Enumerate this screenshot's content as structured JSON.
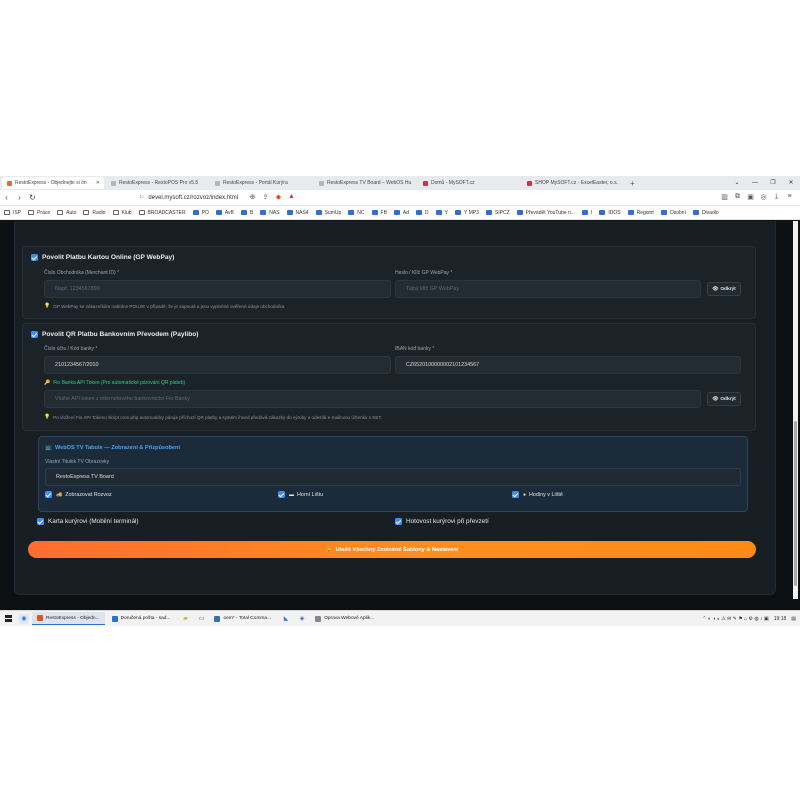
{
  "browser": {
    "tabs": [
      {
        "label": "RestoExpress - Objednejte si ön",
        "active": true
      },
      {
        "label": "RestoExpress - RestoPOS Pro v5.5",
        "active": false
      },
      {
        "label": "RestoExpress - Portál Kurýra",
        "active": false
      },
      {
        "label": "RestoExpress TV Board – WebOS Hu",
        "active": false
      },
      {
        "label": "Domů - MySOFT.cz",
        "active": false
      },
      {
        "label": "SHOP MySOFT.cz - ExcelEaster, o.s.",
        "active": false
      }
    ],
    "url": "devel.mysoft.cz/rozvoz/index.html",
    "bookmarks": [
      "ISP",
      "Práce",
      "Auto",
      "Radio",
      "Klub",
      "BROADCASTER",
      "PO",
      "AvB",
      "B",
      "NAS",
      "NAS4",
      "SumUp",
      "NC",
      "FB",
      "Ad",
      "D",
      "Y",
      "Y MP3",
      "SIPCZ",
      "Převádět YouTube n...",
      "I",
      "IDOS",
      "Registrt",
      "Osobní",
      "Divadlo"
    ]
  },
  "gp_webpay": {
    "title": "Povolit Platbu Kartou Online (GP WebPay)",
    "merchant_label": "Číslo Obchodníka (Merchant ID) *",
    "merchant_placeholder": "Např. 1234567890",
    "key_label": "Heslo / Klíč GP WebPay *",
    "key_placeholder": "Tajný klíč GP WebPay",
    "reveal_label": "Odkrýt",
    "hint": "GP WebPay se zákazníkům nabídne POUZE v případě, že je zapnutá a jsou vyplněné ověřené údaje obchodníka."
  },
  "qr_payment": {
    "title": "Povolit QR Platbu Bankovním Převodem (Paylibo)",
    "account_label": "Číslo účtu / Kód banky *",
    "account_value": "2101234567/2010",
    "iban_label": "IBAN kód banky *",
    "iban_value": "CZ6520100000002101234567",
    "fio_label": "Fio Banka API Token (Pro automatické párování QR plateb)",
    "fio_placeholder": "Vložte API token z internetového bankovnictví Fio Banky",
    "reveal_label": "Odkrýt",
    "hint": "Po vložení Fio API Tokenu skript cron.php automaticky páruje příchozí QR platby a systém ihned předává zákazky do výroby a odesílá e-mailovou účtenku s EET."
  },
  "tv_board": {
    "title": "WebOS TV Tabule — Zobrazení & Přizpůsobení",
    "title_label": "Vlastní Titulek TV Obrazovky",
    "title_value": "RestoExpress TV Board",
    "checks": [
      "Zobrazovat Rozvoz",
      "Horní Lištu",
      "Hodiny v Liště"
    ]
  },
  "courier_card": "Karta kurýrovi (Mobilní terminál)",
  "courier_cash": "Hotovost kurýrovi při převzetí",
  "save_label": "Uložit Všechny Změněné Šablony & Nastavení",
  "taskbar": {
    "items": [
      "RestoExpress - Objedn...",
      "Doručená pošta - sad...",
      "oem* - Total Comma...",
      "Oprava Webové Aplik..."
    ],
    "time": "19:18"
  },
  "colors": {
    "accent_blue": "#3b8ef3",
    "accent_orange": "#ff7a22",
    "fio_green": "#31c98c",
    "tv_title": "#4aa3f5"
  }
}
